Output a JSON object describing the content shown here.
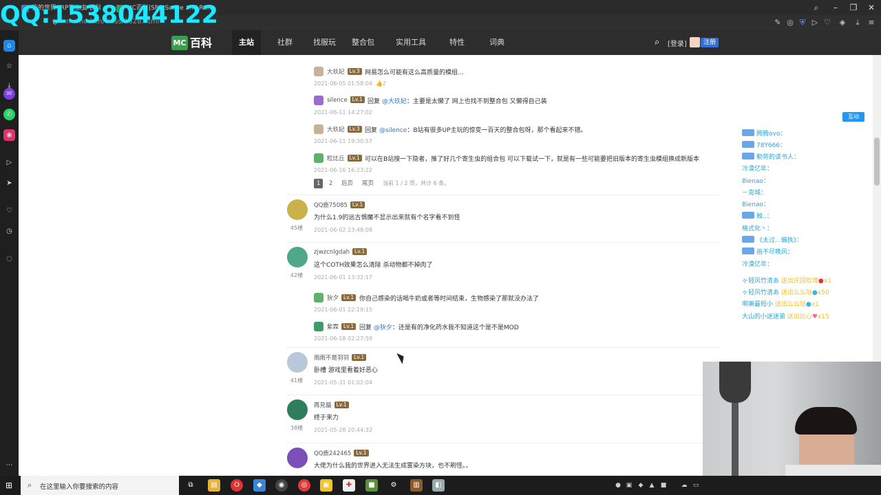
{
  "overlay": {
    "qq": "QQ:1538044122"
  },
  "browser": {
    "tabs": [
      {
        "label": "我的世界SRP寄生虫-百科"
      },
      {
        "label": "MC百科|SRP Scape and Run: Parasites"
      }
    ],
    "url": "mcmod.cn/class/1628.html"
  },
  "site": {
    "logo_mc": "MC",
    "logo_text": "百科",
    "nav": [
      "主站",
      "社群",
      "找服玩",
      "整合包",
      "实用工具",
      "特性",
      "词典"
    ],
    "login": "[登录]",
    "register": "注册"
  },
  "replies_top": [
    {
      "name": "大玖妃",
      "lv": "Lv.3",
      "text": "网易怎么可能有这么高质量的模组...",
      "time": "2021-06-05 01:58:04",
      "likes": "2"
    },
    {
      "name": "silence",
      "lv": "Lv.1",
      "prefix": "回复",
      "at": "@大玖妃",
      "text": "：主要是太懒了 网上也找不到整合包 又懒得自己装",
      "time": "2021-06-11 14:27:02"
    },
    {
      "name": "大玖妃",
      "lv": "Lv.3",
      "prefix": "回复",
      "at": "@silence",
      "text": "：B站有很多UP主玩的惊变一百天的整合包呀，那个看起来不错。",
      "time": "2021-06-11 19:30:57"
    },
    {
      "name": "粒比丘",
      "lv": "Lv.1",
      "text": "可以在B站搜一下隐者，推了好几个寄生虫的组合包 可以下载试一下，就是有一些可能要把旧版本的寄生虫模组换成新版本",
      "time": "2021-06-16 16:23:22"
    }
  ],
  "pager": {
    "p1": "1",
    "p2": "2",
    "next": "后页",
    "last": "尾页",
    "info": "当前 1 / 2 页，共计 6 条。"
  },
  "comments": [
    {
      "name": "QQ鹿75085",
      "lv": "Lv.1",
      "text": "为什么1.9的远古惧魔不显示出来就有个名字看不到怪",
      "floor": "45楼",
      "time": "2021-06-02 23:48:08"
    },
    {
      "name": "zjwzcnlgdah",
      "lv": "Lv.1",
      "text": "这个COTH效果怎么清除 杀动物都不掉肉了",
      "floor": "42楼",
      "time": "2021-06-01 13:32:17"
    },
    {
      "name": "雨雨不是羽羽",
      "lv": "Lv.1",
      "text": "卧槽 游戏里看着好恶心",
      "floor": "41楼",
      "time": "2021-05-31 01:02:04"
    },
    {
      "name": "再見貓",
      "lv": "Lv.1",
      "text": "终于来力",
      "floor": "38楼",
      "time": "2021-05-28 20:44:32"
    },
    {
      "name": "QQ鹿242465",
      "lv": "Lv.1",
      "text": "大佬为什么我的世界进入无法生成雾染方块，也不刷怪。。",
      "floor": "",
      "time": ""
    }
  ],
  "replies_mid": [
    {
      "name": "狄夕",
      "lv": "Lv.1",
      "text": "你自己感染的话喝牛奶或者等时间结束，生物感染了那就没办法了",
      "time": "2021-06-01 22:19:15"
    },
    {
      "name": "紫霖",
      "lv": "Lv.1",
      "prefix": "回复",
      "at": "@狄夕",
      "text": "：还是有的净化药水我不知道这个是不是MOD",
      "time": "2021-06-18 02:27:59"
    }
  ],
  "chat": {
    "button": "互动",
    "lines": [
      {
        "user": "腾腾ovo：",
        "msg": ""
      },
      {
        "user": "78Y666：",
        "msg": ""
      },
      {
        "user": "勤劳的读书人：",
        "msg": ""
      },
      {
        "user": "冷漠亿年：",
        "msg": ""
      },
      {
        "user": "Bienao：",
        "msg": ""
      },
      {
        "user": "－克城：",
        "msg": ""
      },
      {
        "user": "Bienao：",
        "msg": ""
      },
      {
        "user": "蝕..：",
        "msg": ""
      },
      {
        "user": "格式化丶：",
        "msg": ""
      },
      {
        "user": "《太过...偏执》：",
        "msg": ""
      },
      {
        "user": "画不尽晚风：",
        "msg": ""
      },
      {
        "user": "冷漠亿年：",
        "msg": ""
      }
    ],
    "gifts": [
      {
        "user": "ヶ轻风竹清あ",
        "gift": "送出庄园玫瑰",
        "count": "x1"
      },
      {
        "user": "ヶ轻风竹清あ",
        "gift": "送出么么哒",
        "count": "x50"
      },
      {
        "user": "啊嘛最短小",
        "gift": "送出么么哒",
        "count": "x1"
      },
      {
        "user": "大山的小迷迷弟",
        "gift": "送出比心",
        "count": "x15"
      }
    ]
  },
  "taskbar": {
    "search_placeholder": "在这里输入你要搜索的内容"
  }
}
